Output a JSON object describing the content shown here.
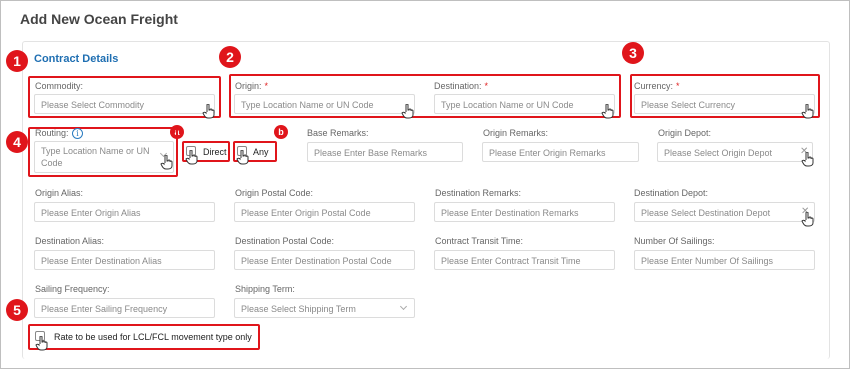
{
  "title": "Add New Ocean Freight",
  "section": "Contract Details",
  "markers": {
    "n1": "1",
    "n2": "2",
    "n3": "3",
    "n4": "4",
    "n5": "5",
    "a": "a",
    "b": "b"
  },
  "commodity": {
    "label": "Commodity:",
    "placeholder": "Please Select Commodity"
  },
  "origin": {
    "label": "Origin:",
    "placeholder": "Type Location Name or UN Code",
    "required": "*"
  },
  "destination": {
    "label": "Destination:",
    "placeholder": "Type Location Name or UN Code",
    "required": "*"
  },
  "currency": {
    "label": "Currency:",
    "placeholder": "Please Select Currency",
    "required": "*"
  },
  "routing": {
    "label": "Routing:",
    "placeholder_line1": "Type Location Name or UN",
    "placeholder_line2": "Code",
    "direct": "Direct",
    "any": "Any"
  },
  "base_remarks": {
    "label": "Base Remarks:",
    "placeholder": "Please Enter Base Remarks"
  },
  "origin_remarks": {
    "label": "Origin Remarks:",
    "placeholder": "Please Enter Origin Remarks"
  },
  "origin_depot": {
    "label": "Origin Depot:",
    "placeholder": "Please Select Origin Depot"
  },
  "origin_alias": {
    "label": "Origin Alias:",
    "placeholder": "Please Enter Origin Alias"
  },
  "origin_postal": {
    "label": "Origin Postal Code:",
    "placeholder": "Please Enter Origin Postal Code"
  },
  "destination_remarks": {
    "label": "Destination Remarks:",
    "placeholder": "Please Enter Destination Remarks"
  },
  "destination_depot": {
    "label": "Destination Depot:",
    "placeholder": "Please Select Destination Depot"
  },
  "destination_alias": {
    "label": "Destination Alias:",
    "placeholder": "Please Enter Destination Alias"
  },
  "destination_postal": {
    "label": "Destination Postal Code:",
    "placeholder": "Please Enter Destination Postal Code"
  },
  "transit_time": {
    "label": "Contract Transit Time:",
    "placeholder": "Please Enter Contract Transit Time"
  },
  "sailings": {
    "label": "Number Of Sailings:",
    "placeholder": "Please Enter Number Of Sailings"
  },
  "sailing_frequency": {
    "label": "Sailing Frequency:",
    "placeholder": "Please Enter Sailing Frequency"
  },
  "shipping_term": {
    "label": "Shipping Term:",
    "placeholder": "Please Select Shipping Term"
  },
  "lcl_fcl": {
    "label": "Rate to be used for LCL/FCL movement type only"
  },
  "colors": {
    "highlight": "#e0151b",
    "link": "#1f6fb2"
  }
}
